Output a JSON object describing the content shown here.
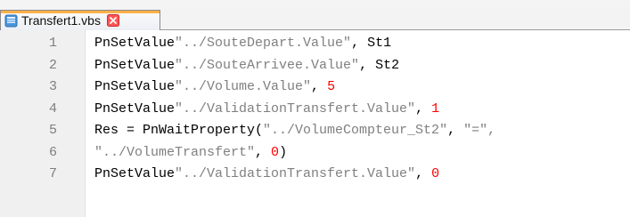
{
  "window": {
    "tab_title": "Transfert1.vbs",
    "tab_accent_color": "#ffb14a",
    "file_icon": "document-icon",
    "close_icon": "close-icon"
  },
  "editor": {
    "lines": [
      {
        "number": "1",
        "segments": [
          {
            "text": "PnSetValue",
            "role": "keyword"
          },
          {
            "text": "\"../SouteDepart.Value\"",
            "role": "string"
          },
          {
            "text": ", St1",
            "role": "punct"
          }
        ]
      },
      {
        "number": "2",
        "segments": [
          {
            "text": "PnSetValue",
            "role": "keyword"
          },
          {
            "text": "\"../SouteArrivee.Value\"",
            "role": "string"
          },
          {
            "text": ", St2",
            "role": "punct"
          }
        ]
      },
      {
        "number": "3",
        "segments": [
          {
            "text": "PnSetValue",
            "role": "keyword"
          },
          {
            "text": "\"../Volume.Value\"",
            "role": "string"
          },
          {
            "text": ", ",
            "role": "punct"
          },
          {
            "text": "5",
            "role": "number"
          }
        ]
      },
      {
        "number": "4",
        "segments": [
          {
            "text": "PnSetValue",
            "role": "keyword"
          },
          {
            "text": "\"../ValidationTransfert.Value\"",
            "role": "string"
          },
          {
            "text": ", ",
            "role": "punct"
          },
          {
            "text": "1",
            "role": "number"
          }
        ]
      },
      {
        "number": "5",
        "segments": [
          {
            "text": "Res = PnWaitProperty(",
            "role": "keyword"
          },
          {
            "text": "\"../VolumeCompteur_St2\"",
            "role": "string"
          },
          {
            "text": ", ",
            "role": "punct"
          },
          {
            "text": "\"=\",",
            "role": "string"
          }
        ]
      },
      {
        "number": "6",
        "segments": [
          {
            "text": "\"../VolumeTransfert\"",
            "role": "string"
          },
          {
            "text": ", ",
            "role": "punct"
          },
          {
            "text": "0",
            "role": "number"
          },
          {
            "text": ")",
            "role": "punct"
          }
        ]
      },
      {
        "number": "7",
        "segments": [
          {
            "text": "PnSetValue",
            "role": "keyword"
          },
          {
            "text": "\"../ValidationTransfert.Value\"",
            "role": "string"
          },
          {
            "text": ", ",
            "role": "punct"
          },
          {
            "text": "0",
            "role": "number"
          }
        ]
      }
    ]
  }
}
